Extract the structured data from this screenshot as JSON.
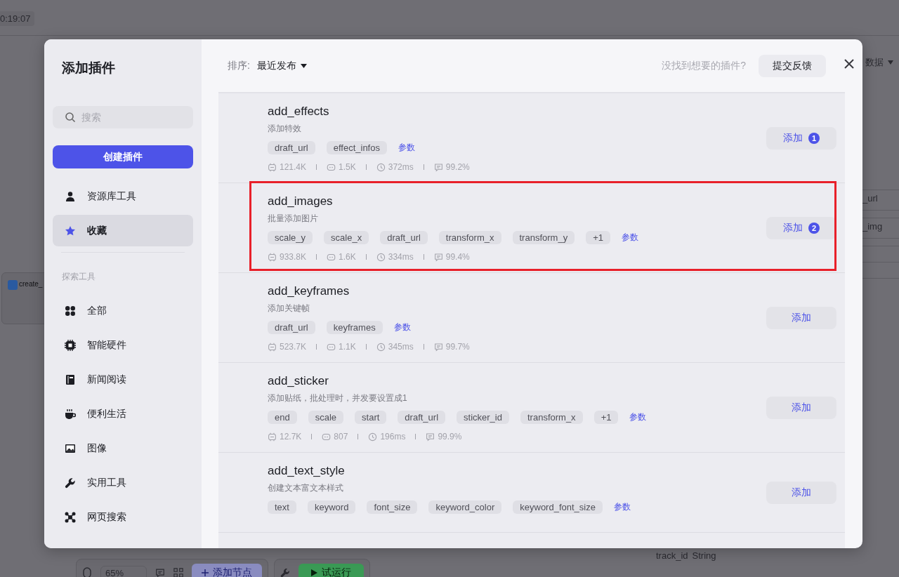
{
  "backdrop": {
    "time": "0:19:07",
    "top_right_label": "数据",
    "node_title": "create_",
    "side_fields": [
      "_url",
      "_img"
    ],
    "side_param": {
      "name": "track_id",
      "type": "String"
    },
    "toolbar": {
      "zoom": "65%",
      "add_node": "添加节点",
      "run": "试运行"
    }
  },
  "dialog": {
    "title": "添加插件",
    "search": {
      "placeholder": "搜索"
    },
    "create_button": "创建插件",
    "nav": [
      {
        "label": "资源库工具",
        "selected": false
      },
      {
        "label": "收藏",
        "selected": true
      }
    ],
    "section_title": "探索工具",
    "categories": [
      {
        "label": "全部",
        "selected": false
      },
      {
        "label": "智能硬件",
        "selected": false
      },
      {
        "label": "新闻阅读",
        "selected": false
      },
      {
        "label": "便利生活",
        "selected": false
      },
      {
        "label": "图像",
        "selected": false
      },
      {
        "label": "实用工具",
        "selected": false
      },
      {
        "label": "网页搜索",
        "selected": false
      }
    ],
    "sort_label": "排序:",
    "sort_value": "最近发布",
    "feedback_prompt": "没找到想要的插件?",
    "feedback_button": "提交反馈",
    "plugins": [
      {
        "name": "add_effects",
        "description": "添加特效",
        "params": [
          "draft_url",
          "effect_infos"
        ],
        "params_link": "参数",
        "stats": [
          {
            "kind": "calls",
            "value": "121.4K"
          },
          {
            "kind": "bots",
            "value": "1.5K"
          },
          {
            "kind": "time",
            "value": "372ms"
          },
          {
            "kind": "rate",
            "value": "99.2%"
          }
        ],
        "add_label": "添加",
        "add_badge": "1",
        "highlighted": false
      },
      {
        "name": "add_images",
        "description": "批量添加图片",
        "params": [
          "scale_y",
          "scale_x",
          "draft_url",
          "transform_x",
          "transform_y",
          "+1"
        ],
        "params_link": "参数",
        "stats": [
          {
            "kind": "calls",
            "value": "933.8K"
          },
          {
            "kind": "bots",
            "value": "1.6K"
          },
          {
            "kind": "time",
            "value": "334ms"
          },
          {
            "kind": "rate",
            "value": "99.4%"
          }
        ],
        "add_label": "添加",
        "add_badge": "2",
        "highlighted": true
      },
      {
        "name": "add_keyframes",
        "description": "添加关键帧",
        "params": [
          "draft_url",
          "keyframes"
        ],
        "params_link": "参数",
        "stats": [
          {
            "kind": "calls",
            "value": "523.7K"
          },
          {
            "kind": "bots",
            "value": "1.1K"
          },
          {
            "kind": "time",
            "value": "345ms"
          },
          {
            "kind": "rate",
            "value": "99.7%"
          }
        ],
        "add_label": "添加",
        "highlighted": false
      },
      {
        "name": "add_sticker",
        "description": "添加贴纸，批处理时，并发要设置成1",
        "params": [
          "end",
          "scale",
          "start",
          "draft_url",
          "sticker_id",
          "transform_x",
          "+1"
        ],
        "params_link": "参数",
        "stats": [
          {
            "kind": "calls",
            "value": "12.7K"
          },
          {
            "kind": "bots",
            "value": "807"
          },
          {
            "kind": "time",
            "value": "196ms"
          },
          {
            "kind": "rate",
            "value": "99.9%"
          }
        ],
        "add_label": "添加",
        "highlighted": false
      },
      {
        "name": "add_text_style",
        "description": "创建文本富文本样式",
        "params": [
          "text",
          "keyword",
          "font_size",
          "keyword_color",
          "keyword_font_size"
        ],
        "params_link": "参数",
        "add_label": "添加",
        "highlighted": false
      }
    ]
  }
}
